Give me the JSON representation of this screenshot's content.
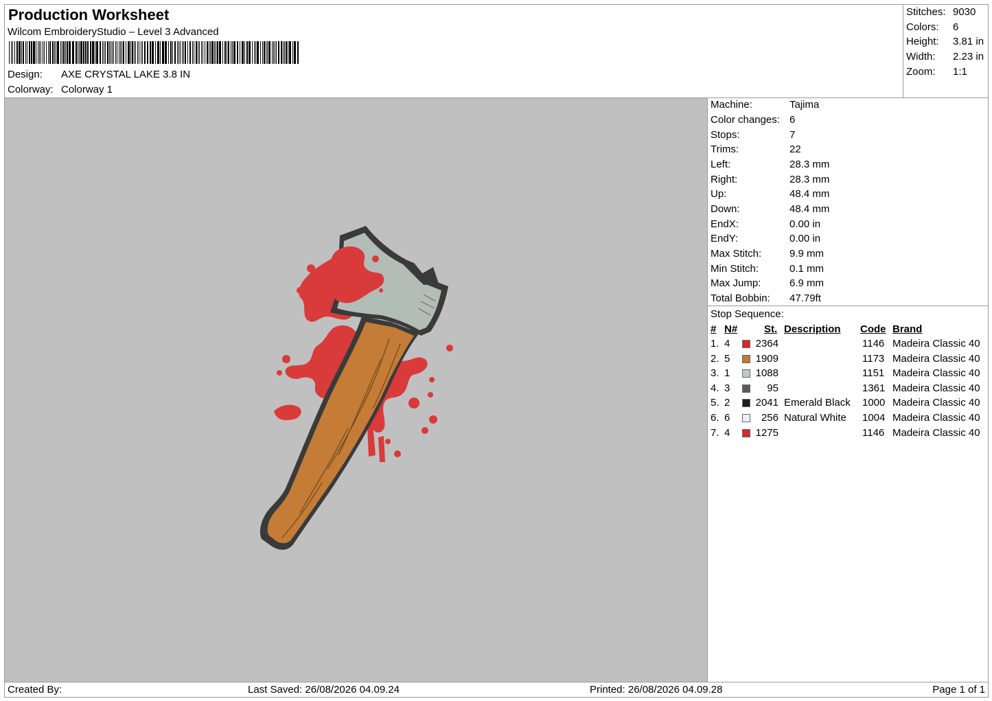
{
  "header": {
    "title": "Production Worksheet",
    "software": "Wilcom EmbroideryStudio – Level 3 Advanced",
    "design_label": "Design:",
    "design_value": "AXE CRYSTAL LAKE 3.8 IN",
    "colorway_label": "Colorway:",
    "colorway_value": "Colorway 1"
  },
  "summary": [
    {
      "label": "Stitches:",
      "value": "9030"
    },
    {
      "label": "Colors:",
      "value": "6"
    },
    {
      "label": "Height:",
      "value": "3.81 in"
    },
    {
      "label": "Width:",
      "value": "2.23 in"
    },
    {
      "label": "Zoom:",
      "value": "1:1"
    }
  ],
  "machine": [
    {
      "label": "Machine:",
      "value": "Tajima"
    },
    {
      "label": "Color changes:",
      "value": "6"
    },
    {
      "label": "Stops:",
      "value": "7"
    },
    {
      "label": "Trims:",
      "value": "22"
    },
    {
      "label": "Left:",
      "value": "28.3 mm"
    },
    {
      "label": "Right:",
      "value": "28.3 mm"
    },
    {
      "label": "Up:",
      "value": "48.4 mm"
    },
    {
      "label": "Down:",
      "value": "48.4 mm"
    },
    {
      "label": "EndX:",
      "value": "0.00 in"
    },
    {
      "label": "EndY:",
      "value": "0.00 in"
    },
    {
      "label": "Max Stitch:",
      "value": "9.9 mm"
    },
    {
      "label": "Min Stitch:",
      "value": "0.1 mm"
    },
    {
      "label": "Max Jump:",
      "value": "6.9 mm"
    },
    {
      "label": "Total Bobbin:",
      "value": "47.79ft"
    }
  ],
  "stops": {
    "title": "Stop Sequence:",
    "headers": {
      "num": "#",
      "needle": "N#",
      "stitches": "St.",
      "description": "Description",
      "code": "Code",
      "brand": "Brand"
    },
    "rows": [
      {
        "num": "1.",
        "needle": "4",
        "color": "#d42a2a",
        "stitches": "2364",
        "description": "",
        "code": "1146",
        "brand": "Madeira Classic 40"
      },
      {
        "num": "2.",
        "needle": "5",
        "color": "#c07a3a",
        "stitches": "1909",
        "description": "",
        "code": "1173",
        "brand": "Madeira Classic 40"
      },
      {
        "num": "3.",
        "needle": "1",
        "color": "#c4c8cc",
        "stitches": "1088",
        "description": "",
        "code": "1151",
        "brand": "Madeira Classic 40"
      },
      {
        "num": "4.",
        "needle": "3",
        "color": "#5a5a5a",
        "stitches": "95",
        "description": "",
        "code": "1361",
        "brand": "Madeira Classic 40"
      },
      {
        "num": "5.",
        "needle": "2",
        "color": "#1e1e1e",
        "stitches": "2041",
        "description": "Emerald Black",
        "code": "1000",
        "brand": "Madeira Classic 40"
      },
      {
        "num": "6.",
        "needle": "6",
        "color": "#eeeef4",
        "stitches": "256",
        "description": "Natural White",
        "code": "1004",
        "brand": "Madeira Classic 40"
      },
      {
        "num": "7.",
        "needle": "4",
        "color": "#d42a2a",
        "stitches": "1275",
        "description": "",
        "code": "1146",
        "brand": "Madeira Classic 40"
      }
    ]
  },
  "footer": {
    "created_by": "Created By:",
    "last_saved": "Last Saved: 26/08/2026 04.09.24",
    "printed": "Printed: 26/08/2026 04.09.28",
    "page": "Page 1 of 1"
  },
  "colors": {
    "canvas_bg": "#c0c0c0",
    "blood": "#d93a3a",
    "handle": "#c47c36",
    "blade": "#b3bdb7",
    "outline": "#3a3a3a"
  }
}
